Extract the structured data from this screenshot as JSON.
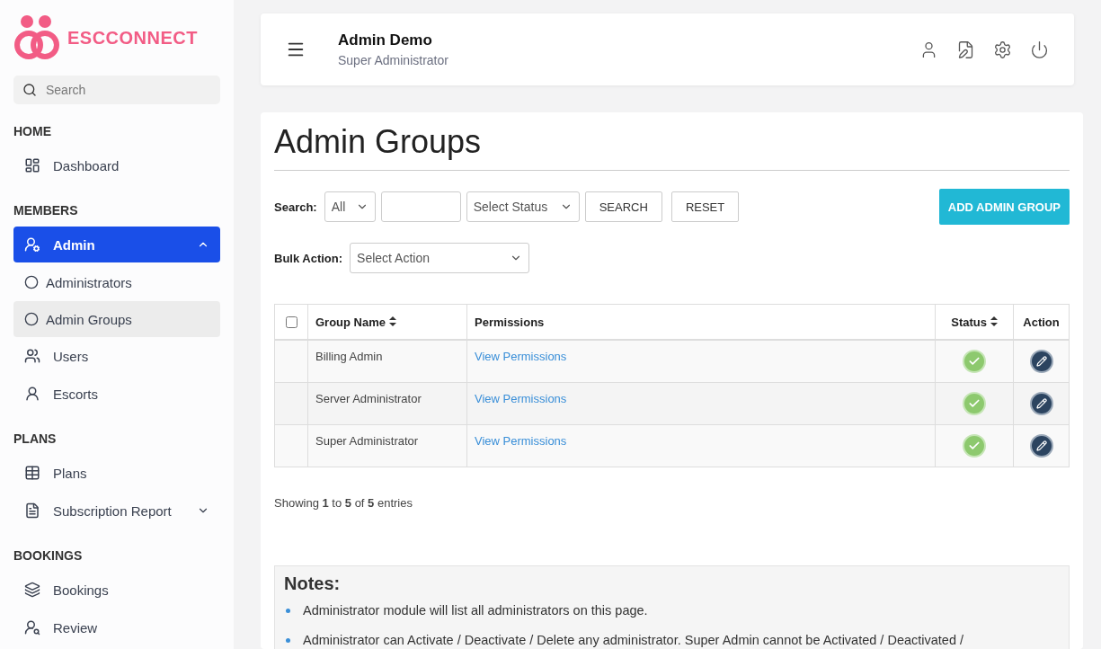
{
  "sidebar": {
    "logo": "ESCCONNECT",
    "search": {
      "placeholder": "Search"
    },
    "sections": [
      {
        "title": "HOME",
        "items": [
          {
            "label": "Dashboard",
            "selected": false
          }
        ]
      },
      {
        "title": "MEMBERS",
        "items": [
          {
            "label": "Admin",
            "selected": true,
            "expanded": true,
            "children": [
              {
                "label": "Administrators",
                "selected": false
              },
              {
                "label": "Admin Groups",
                "selected": true
              }
            ]
          },
          {
            "label": "Users",
            "selected": false
          },
          {
            "label": "Escorts",
            "selected": false
          }
        ]
      },
      {
        "title": "PLANS",
        "items": [
          {
            "label": "Plans",
            "selected": false
          },
          {
            "label": "Subscription Report",
            "selected": false,
            "expanded": false
          }
        ]
      },
      {
        "title": "BOOKINGS",
        "items": [
          {
            "label": "Bookings",
            "selected": false
          },
          {
            "label": "Review",
            "selected": false
          }
        ]
      }
    ]
  },
  "header": {
    "name": "Admin Demo",
    "role": "Super Administrator"
  },
  "page": {
    "title": "Admin Groups",
    "filters": {
      "search_label": "Search:",
      "field_select": "All",
      "status_select": "Select Status",
      "search_button": "SEARCH",
      "reset_button": "RESET",
      "add_button": "ADD ADMIN GROUP"
    },
    "bulk": {
      "label": "Bulk Action:",
      "select": "Select Action"
    },
    "table": {
      "select_all_checked": false,
      "columns": [
        "Group Name",
        "Permissions",
        "Status",
        "Action"
      ],
      "rows": [
        {
          "name": "Billing Admin",
          "permissions": "View Permissions",
          "active": true
        },
        {
          "name": "Server Administrator",
          "permissions": "View Permissions",
          "active": true
        },
        {
          "name": "Super Administrator",
          "permissions": "View Permissions",
          "active": true
        }
      ]
    },
    "showing": "Showing **1** to **5** of **5** entries",
    "notes": {
      "title": "Notes:",
      "items": [
        "Administrator module will list all administrators on this page.",
        "Administrator can Activate / Deactivate / Delete any administrator. Super Admin cannot be Activated / Deactivated /"
      ]
    }
  }
}
